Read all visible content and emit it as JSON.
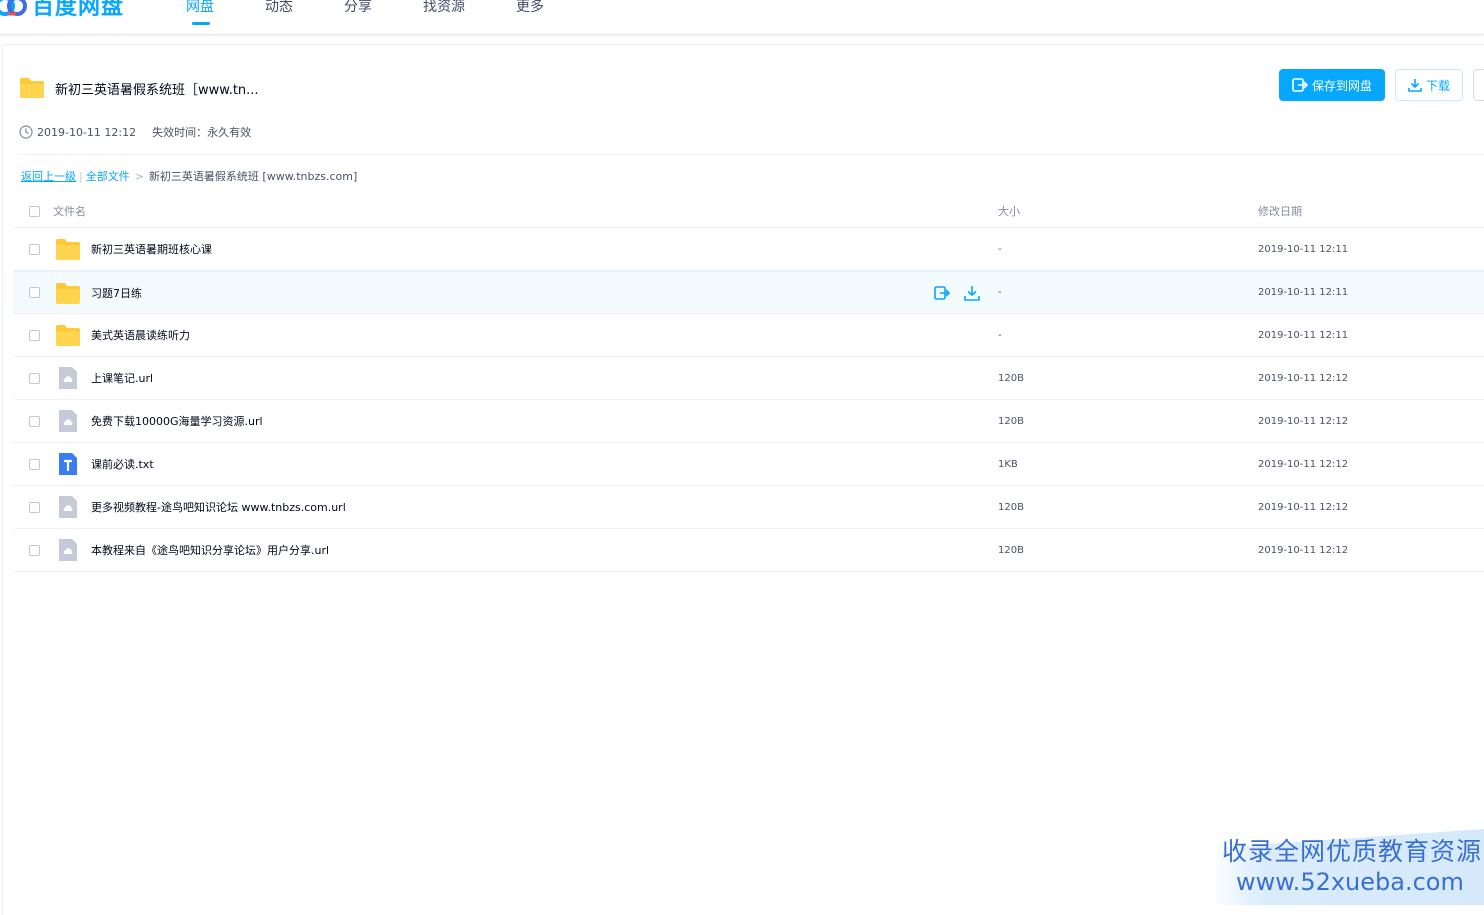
{
  "app": {
    "logo_text": "百度网盘",
    "brand_color": "#06a7ff"
  },
  "nav": {
    "items": [
      {
        "label": "网盘",
        "active": true
      },
      {
        "label": "动态",
        "active": false
      },
      {
        "label": "分享",
        "active": false
      },
      {
        "label": "找资源",
        "active": false
      },
      {
        "label": "更多",
        "active": false
      }
    ]
  },
  "share": {
    "title": "新初三英语暑假系统班［www.tn...",
    "created": "2019-10-11 12:12",
    "expire_label": "失效时间：",
    "expire_value": "永久有效",
    "save_button": "保存到网盘",
    "download_button": "下载"
  },
  "breadcrumb": {
    "back": "返回上一级",
    "divider": "|",
    "all_files": "全部文件",
    "separator": ">",
    "current": "新初三英语暑假系统班 [www.tnbzs.com]"
  },
  "table": {
    "headers": {
      "name": "文件名",
      "size": "大小",
      "date": "修改日期"
    },
    "rows": [
      {
        "name": "新初三英语暑期班核心课",
        "type": "folder",
        "size": "-",
        "date": "2019-10-11 12:11"
      },
      {
        "name": "习题7日练",
        "type": "folder",
        "size": "-",
        "date": "2019-10-11 12:11",
        "hovered": true
      },
      {
        "name": "美式英语晨读练听力",
        "type": "folder",
        "size": "-",
        "date": "2019-10-11 12:11"
      },
      {
        "name": "上课笔记.url",
        "type": "url",
        "size": "120B",
        "date": "2019-10-11 12:12"
      },
      {
        "name": "免费下载10000G海量学习资源.url",
        "type": "url",
        "size": "120B",
        "date": "2019-10-11 12:12"
      },
      {
        "name": "课前必读.txt",
        "type": "txt",
        "size": "1KB",
        "date": "2019-10-11 12:12"
      },
      {
        "name": "更多视频教程-途鸟吧知识论坛 www.tnbzs.com.url",
        "type": "url",
        "size": "120B",
        "date": "2019-10-11 12:12"
      },
      {
        "name": "本教程来自《途鸟吧知识分享论坛》用户分享.url",
        "type": "url",
        "size": "120B",
        "date": "2019-10-11 12:12"
      }
    ]
  },
  "watermark": {
    "line1": "收录全网优质教育资源",
    "line2": "www.52xueba.com"
  }
}
